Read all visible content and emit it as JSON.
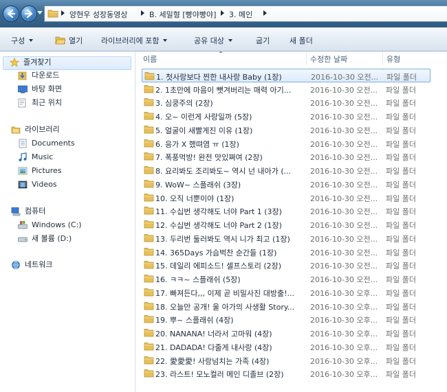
{
  "address": {
    "crumbs": [
      "양현우 성장동영상",
      "B. 세밀형 [빵야빵야]",
      "3. 메인"
    ]
  },
  "toolbar": {
    "organize": "구성",
    "open": "열기",
    "include_library": "라이브러리에 포함",
    "share_with": "공유 대상",
    "burn": "굽기",
    "new_folder": "새 폴더"
  },
  "nav": {
    "favorites": "즐겨찾기",
    "downloads": "다운로드",
    "desktop": "바탕 화면",
    "recent": "최근 위치",
    "libraries": "라이브러리",
    "documents": "Documents",
    "music": "Music",
    "pictures": "Pictures",
    "videos": "Videos",
    "computer": "컴퓨터",
    "drive_c": "Windows (C:)",
    "drive_d": "새 볼륨 (D:)",
    "network": "네트워크"
  },
  "columns": {
    "name": "이름",
    "date": "수정한 날짜",
    "type": "유형"
  },
  "files": [
    {
      "name": "1. 첫사랑보다 찐한 내사랑 Baby (1장)",
      "date": "2016-10-30 오전...",
      "type": "파일 폴더"
    },
    {
      "name": "2. 1초만에 마음이 뺏겨버리는 매력 아기...",
      "date": "2016-10-30 오전...",
      "type": "파일 폴더"
    },
    {
      "name": "3. 심쿵주의 (2장)",
      "date": "2016-10-30 오전...",
      "type": "파일 폴더"
    },
    {
      "name": "4. 오~ 이런게 사랑일까 (5장)",
      "date": "2016-10-30 오전...",
      "type": "파일 폴더"
    },
    {
      "name": "5. 얼굴이 새빨게진 이유 (1장)",
      "date": "2016-10-30 오전...",
      "type": "파일 폴더"
    },
    {
      "name": "6. 응가 X 했뗘염 ㅠ (1장)",
      "date": "2016-10-30 오전...",
      "type": "파일 폴더"
    },
    {
      "name": "7. 폭풍먹방! 완전 맛있쪄여 (2장)",
      "date": "2016-10-30 오전...",
      "type": "파일 폴더"
    },
    {
      "name": "8. 요리봐도 조리봐도~ 역시 넌 내아가 (...",
      "date": "2016-10-30 오전...",
      "type": "파일 폴더"
    },
    {
      "name": "9. WoW~ 스플래쉬 (3장)",
      "date": "2016-10-30 오전...",
      "type": "파일 폴더"
    },
    {
      "name": "10. 오직 너뿐이야 (1장)",
      "date": "2016-10-30 오전...",
      "type": "파일 폴더"
    },
    {
      "name": "11. 수십번 생각해도 너야 Part 1 (3장)",
      "date": "2016-10-30 오전...",
      "type": "파일 폴더"
    },
    {
      "name": "12. 수십번 생각해도 너야 Part 2 (1장)",
      "date": "2016-10-30 오전...",
      "type": "파일 폴더"
    },
    {
      "name": "13. 두리번 둘러봐도 역시 니가 최고 (1장)",
      "date": "2016-10-30 오전...",
      "type": "파일 폴더"
    },
    {
      "name": "14. 365Days 가슴벅찬 순간들 (1장)",
      "date": "2016-10-30 오전...",
      "type": "파일 폴더"
    },
    {
      "name": "15. 데일리 에피소드! 셀프스토리 (2장)",
      "date": "2016-10-30 오전...",
      "type": "파일 폴더"
    },
    {
      "name": "16. ㅋㅋ~ 스플래쉬 (5장)",
      "date": "2016-10-30 오전...",
      "type": "파일 폴더"
    },
    {
      "name": "17. 빠져든다,,, 이제 곧 비밀사진 대방출!...",
      "date": "2016-10-30 오후...",
      "type": "파일 폴더"
    },
    {
      "name": "18. 오늘만 공개! 울 아가의 사생활 Story...",
      "date": "2016-10-30 오후...",
      "type": "파일 폴더"
    },
    {
      "name": "19. 뿌~ 스플래쉬 (4장)",
      "date": "2016-10-30 오후...",
      "type": "파일 폴더"
    },
    {
      "name": "20. NANANA! 너라서 고마워 (4장)",
      "date": "2016-10-30 오후...",
      "type": "파일 폴더"
    },
    {
      "name": "21. DADADA! 다줄게 내사랑 (4장)",
      "date": "2016-10-30 오후...",
      "type": "파일 폴더"
    },
    {
      "name": "22. 愛愛愛! 사랑넘치는 가족 (4장)",
      "date": "2016-10-30 오후...",
      "type": "파일 폴더"
    },
    {
      "name": "23. 라스트! 모노컬러 메인 디졸브 (2장)",
      "date": "2016-10-30 오후...",
      "type": "파일 폴더"
    }
  ],
  "selected_index": 0,
  "colors": {
    "folder": "#e7c05a",
    "selection_border": "#84acdd",
    "accent": "#3c6b93"
  }
}
